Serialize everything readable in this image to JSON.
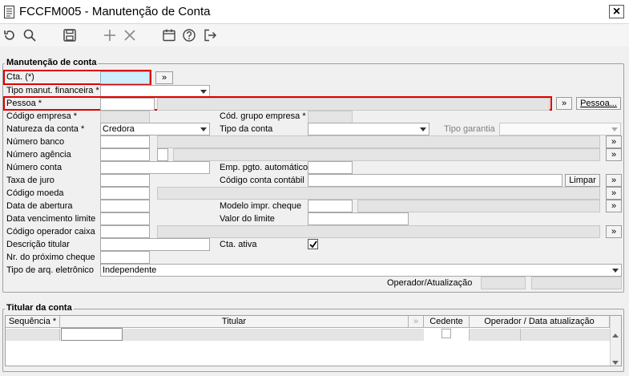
{
  "window": {
    "title": "FCCFM005 - Manutenção de Conta",
    "close_label": "×"
  },
  "toolbar": {
    "icons": [
      "refresh-icon",
      "search-icon",
      "save-icon",
      "add-icon",
      "cancel-icon",
      "calendar-icon",
      "help-icon",
      "exit-icon"
    ]
  },
  "form": {
    "legend": "Manutenção de conta",
    "cta_label": "Cta. (*)",
    "tipo_manut_label": "Tipo manut. financeira *",
    "pessoa_label": "Pessoa *",
    "pessoa_button": "Pessoa...",
    "codigo_empresa_label": "Código empresa *",
    "cod_grupo_empresa_label": "Cód. grupo empresa *",
    "natureza_label": "Natureza da conta *",
    "natureza_value": "Credora",
    "tipo_conta_label": "Tipo da conta",
    "tipo_garantia_label": "Tipo garantia",
    "numero_banco_label": "Número banco",
    "numero_agencia_label": "Número agência",
    "numero_conta_label": "Número conta",
    "emp_pgto_label": "Emp. pgto. automático",
    "taxa_juro_label": "Taxa de juro",
    "codigo_contabil_label": "Código conta contábil",
    "limpar_button": "Limpar",
    "codigo_moeda_label": "Código moeda",
    "data_abertura_label": "Data de abertura",
    "modelo_cheque_label": "Modelo impr. cheque",
    "data_vencimento_label": "Data vencimento limite",
    "valor_limite_label": "Valor do limite",
    "codigo_operador_label": "Código operador caixa",
    "descricao_titular_label": "Descrição titular",
    "cta_ativa_label": "Cta. ativa",
    "nr_cheque_label": "Nr. do próximo cheque",
    "tipo_arq_label": "Tipo de arq. eletrônico",
    "tipo_arq_value": "Independente",
    "operador_label": "Operador/Atualização",
    "lookup_button": "»"
  },
  "titular": {
    "legend": "Titular da conta",
    "columns": [
      "Sequência *",
      "Titular",
      "Cedente",
      "Operador / Data atualização"
    ],
    "mini_col": "»"
  }
}
